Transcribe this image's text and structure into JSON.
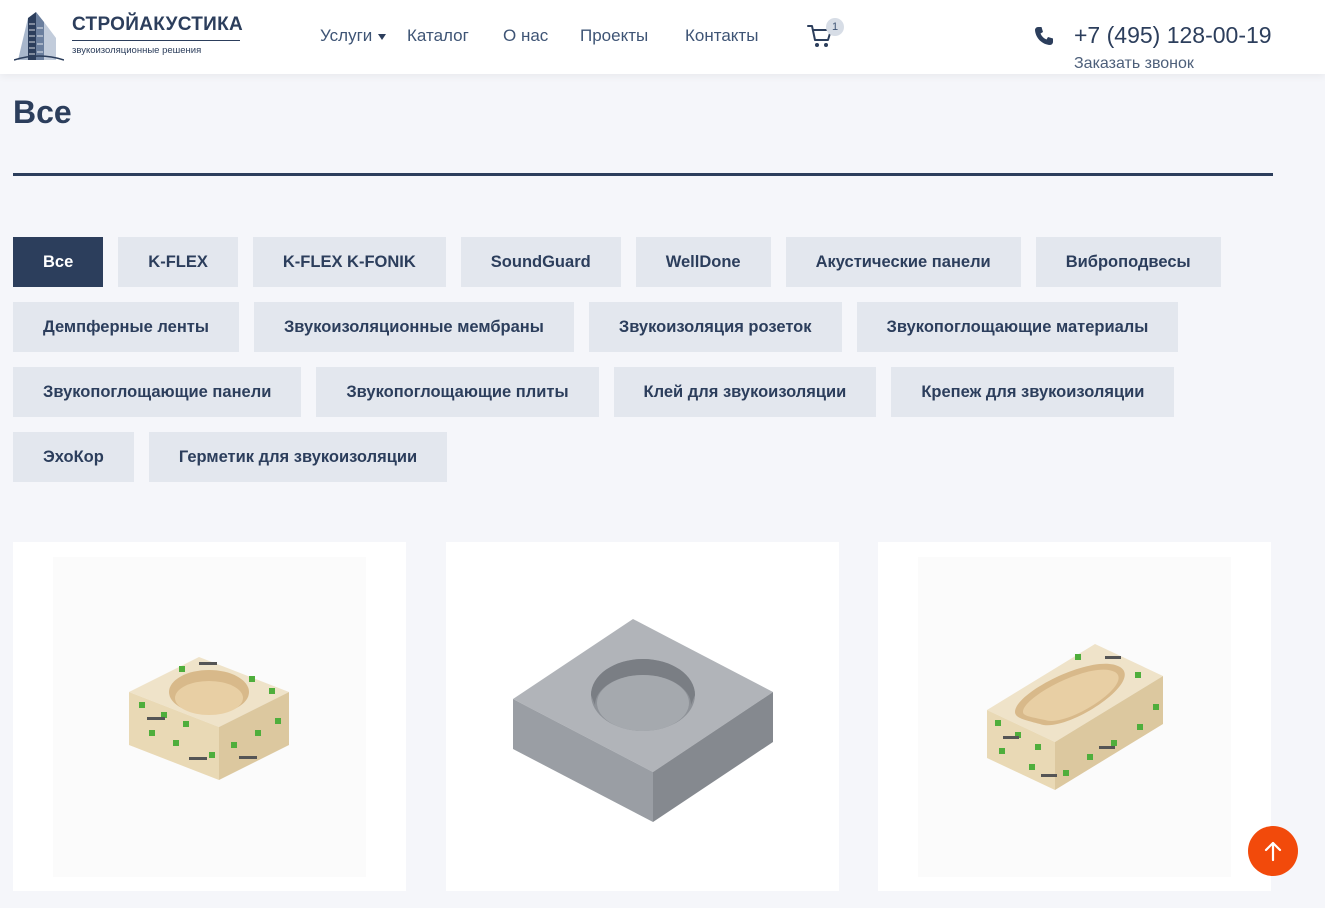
{
  "header": {
    "logo_title": "СТРОЙАКУСТИКА",
    "logo_subtitle": "звукоизоляционные решения",
    "nav": {
      "services": "Услуги",
      "catalog": "Каталог",
      "about": "О нас",
      "projects": "Проекты",
      "contacts": "Контакты"
    },
    "cart_count": "1",
    "phone": "+7 (495) 128-00-19",
    "callback": "Заказать звонок"
  },
  "page": {
    "title": "Все"
  },
  "filters": {
    "rows": [
      [
        "Все",
        "K-FLEX",
        "K-FLEX K-FONIK",
        "SoundGuard",
        "WellDone",
        "Акустические панели",
        "Виброподвесы"
      ],
      [
        "Демпферные ленты",
        "Звукоизоляционные мембраны",
        "Звукоизоляция розеток",
        "Звукопоглощающие материалы"
      ],
      [
        "Звукопоглощающие панели",
        "Звукопоглощающие плиты",
        "Клей для звукоизоляции",
        "Крепеж для звукоизоляции"
      ],
      [
        "ЭхоКор",
        "Герметик для звукоизоляции"
      ]
    ],
    "active": "Все"
  },
  "products": [
    {
      "image": "round-socket-box-soundguard"
    },
    {
      "image": "grey-square-block-round-hole"
    },
    {
      "image": "oval-socket-box-soundguard"
    }
  ],
  "colors": {
    "primary": "#2c3e5c",
    "chip_bg": "#e3e7ee",
    "page_bg": "#f5f6fa",
    "accent": "#f24a0b"
  },
  "icons": {
    "logo": "building-logo-icon",
    "cart": "cart-icon",
    "phone": "phone-icon",
    "scroll_top": "arrow-up-icon"
  }
}
